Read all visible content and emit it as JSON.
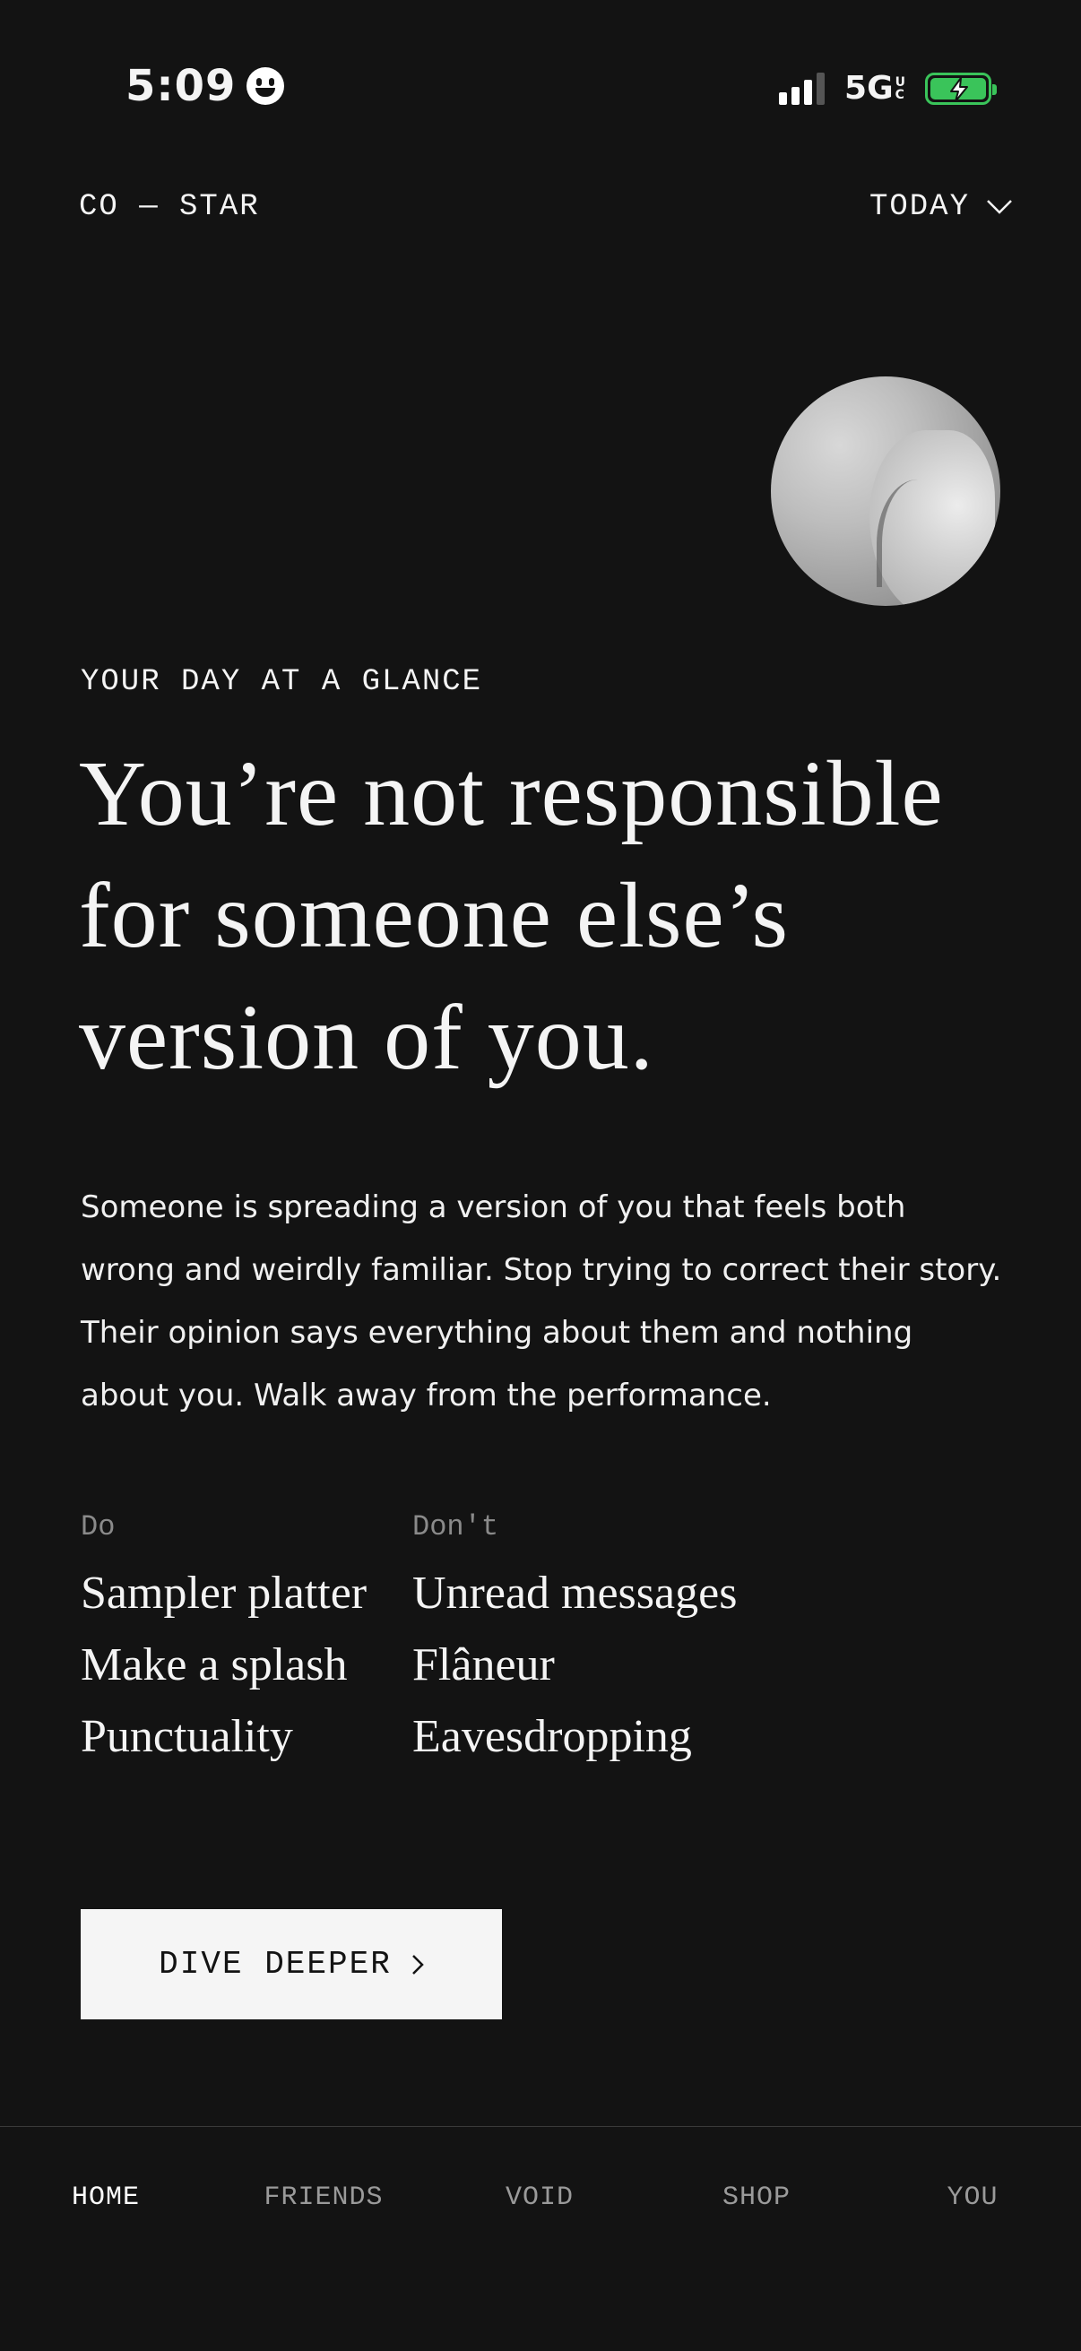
{
  "status_bar": {
    "time": "5:09",
    "network": "5G",
    "network_suffix_top": "U",
    "network_suffix_bottom": "C"
  },
  "header": {
    "logo": "CO — STAR",
    "period_label": "TODAY"
  },
  "main": {
    "eyebrow": "YOUR DAY AT A GLANCE",
    "headline": "You’re not responsible for someone else’s version of you.",
    "body": "Someone is spreading a version of you that feels both wrong and weirdly familiar. Stop trying to correct their story. Their opinion says everything about them and nothing about you. Walk away from the performance.",
    "do": {
      "heading": "Do",
      "items": [
        "Sampler platter",
        "Make a splash",
        "Punctuality"
      ]
    },
    "dont": {
      "heading": "Don't",
      "items": [
        "Unread messages",
        "Flâneur",
        "Eavesdropping"
      ]
    },
    "cta_label": "DIVE DEEPER"
  },
  "tabbar": {
    "tabs": [
      {
        "label": "HOME",
        "active": true
      },
      {
        "label": "FRIENDS",
        "active": false
      },
      {
        "label": "VOID",
        "active": false
      },
      {
        "label": "SHOP",
        "active": false
      },
      {
        "label": "YOU",
        "active": false
      }
    ]
  },
  "colors": {
    "background": "#131313",
    "text": "#f4f4f4",
    "muted": "#9a9a9a",
    "battery": "#3ac45a",
    "button_bg": "#f5f5f5"
  }
}
